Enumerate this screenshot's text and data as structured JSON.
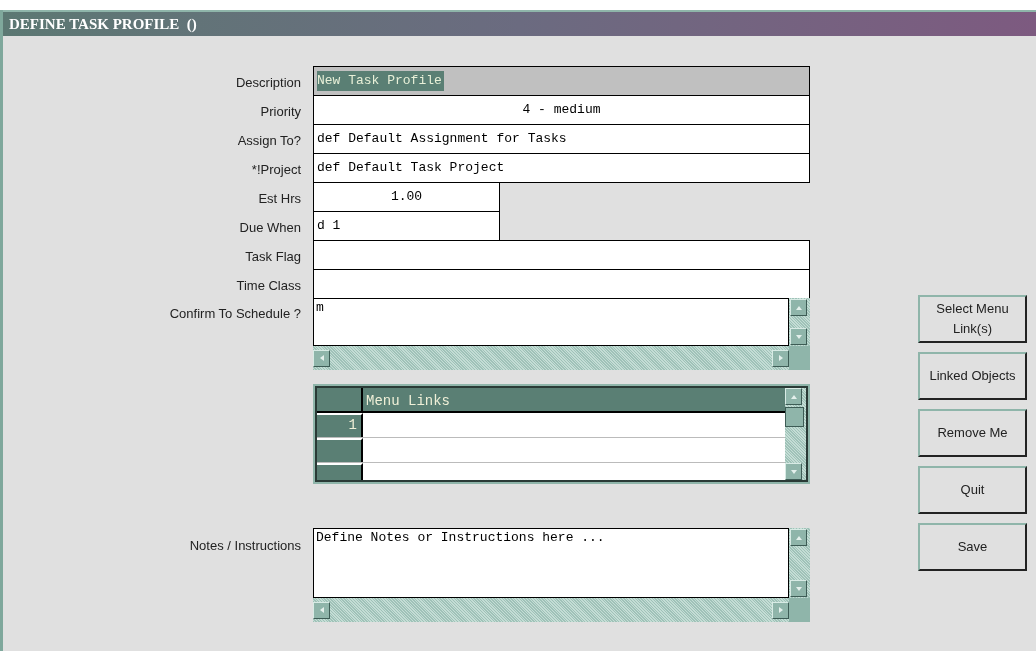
{
  "window": {
    "title": "DEFINE TASK PROFILE  ()"
  },
  "fields": [
    {
      "label": "Description",
      "kind": "text",
      "value": "New Task Profile",
      "focused": true
    },
    {
      "label": "Priority",
      "kind": "centered",
      "value": "4 - medium",
      "focused": false
    },
    {
      "label": "Assign To?",
      "kind": "text",
      "value": "def Default Assignment for Tasks",
      "focused": false
    },
    {
      "label": "*!Project",
      "kind": "text",
      "value": "def Default Task Project",
      "focused": false
    },
    {
      "label": "Est Hrs",
      "kind": "number",
      "value": "1.00",
      "focused": false
    },
    {
      "label": "Due When",
      "kind": "short",
      "value": "d 1",
      "focused": false
    },
    {
      "label": "Task Flag",
      "kind": "text",
      "focused": false
    },
    {
      "label": "Time Class",
      "kind": "text",
      "focused": false
    },
    {
      "label": "Confirm To Schedule ?",
      "kind": "memo",
      "value": "m"
    }
  ],
  "menu_links": {
    "column": "Menu Links",
    "rows": [
      {
        "number": "1"
      }
    ]
  },
  "notes": {
    "label": "Notes / Instructions",
    "value": "Define Notes or Instructions here ..."
  },
  "buttons": [
    "Select Menu Link(s)",
    "Linked Objects",
    "Remove Me",
    "Quit",
    "Save"
  ]
}
